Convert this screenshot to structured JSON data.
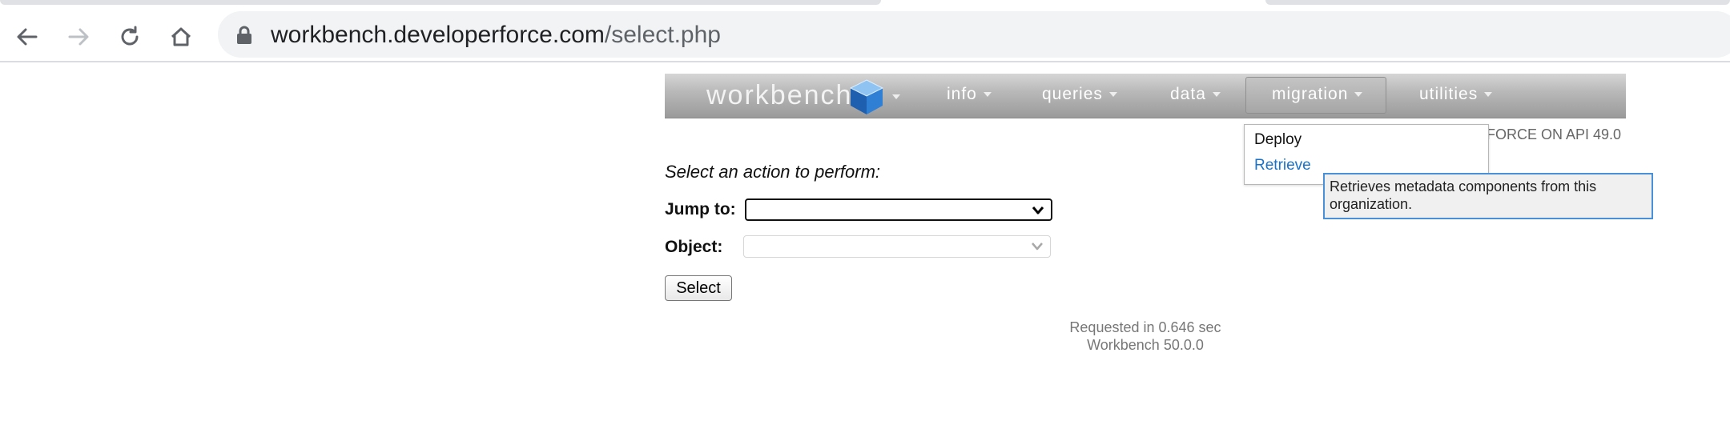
{
  "browser": {
    "url_host": "workbench.developerforce.com",
    "url_path": "/select.php"
  },
  "header": {
    "logo_text": "workbench",
    "menu": [
      {
        "label": "info"
      },
      {
        "label": "queries"
      },
      {
        "label": "data"
      },
      {
        "label": "migration"
      },
      {
        "label": "utilities"
      }
    ],
    "api_note": "FORCE ON API 49.0"
  },
  "migration_menu": {
    "items": [
      {
        "label": "Deploy"
      },
      {
        "label": "Retrieve"
      }
    ],
    "tooltip": "Retrieves metadata components from this organization."
  },
  "form": {
    "prompt": "Select an action to perform:",
    "jump_label": "Jump to:",
    "jump_value": "",
    "object_label": "Object:",
    "object_value": "",
    "submit_label": "Select"
  },
  "footer": {
    "timing": "Requested in 0.646 sec",
    "version": "Workbench 50.0.0"
  },
  "colors": {
    "link": "#1a73c8",
    "focus_border": "#4a90d9"
  }
}
